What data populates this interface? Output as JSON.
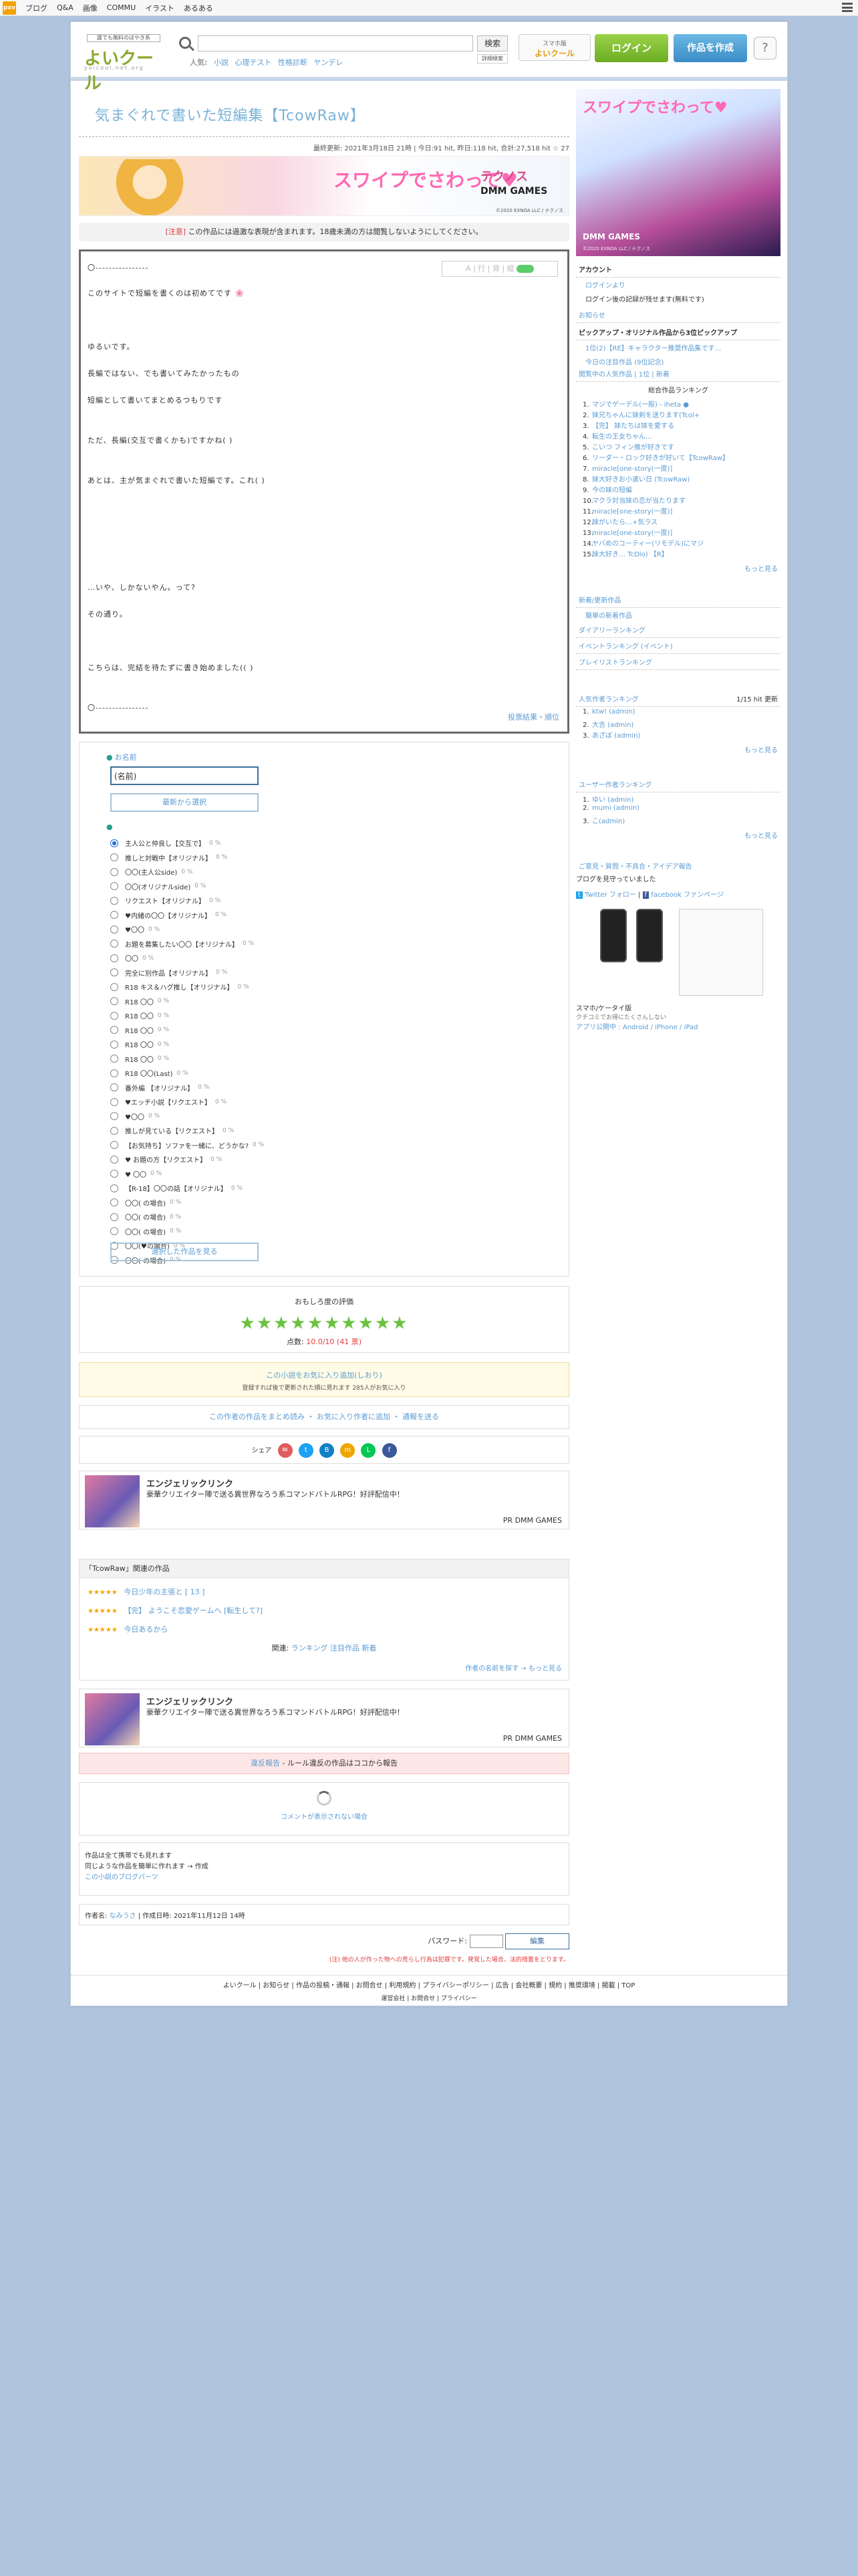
{
  "topnav": {
    "logo": "pxv",
    "items": [
      "ブログ",
      "Q&A",
      "画像",
      "COMMU",
      "イラスト",
      "あるある"
    ]
  },
  "header": {
    "tagline": "誰でも無料のぼやき系",
    "wordmark": "よいクール",
    "wordmark_sub": "yoicool.net.org",
    "search_placeholder": "",
    "search_button": "検索",
    "search_detail": "詳細検索",
    "hints_label": "人気:",
    "hints": [
      "小説",
      "心理テスト",
      "性格診断",
      "ヤンデレ"
    ],
    "mobile_badge_top": "スマホ版",
    "mobile_badge_name": "よいクール",
    "login": "ログイン",
    "post": "作品を作成",
    "help": "?"
  },
  "work": {
    "title": "気まぐれで書いた短編集【TcowRaw】",
    "meta": "最終更新: 2021年3月18日 21時 | 今日:91 hit, 昨日:118 hit, 合計:27,518 hit ☆ 27",
    "notice_tag": "[注意]",
    "notice": "この作品には過激な表現が含まれます。18歳未満の方は閲覧しないようにしてください。",
    "controls": "A | 行 | 背 | 縦",
    "lines": [
      "〇----------------",
      "このサイトで短編を書くのは初めてです 🌸",
      "ゆるいです。",
      "長編ではない、でも書いてみたかったもの",
      "短編として書いてまとめるつもりです",
      "ただ、長編(交互で書くかも)ですかね( )",
      "あとは、主が気まぐれで書いた短編です。これ( )",
      "…いや、しかないやん。って?",
      "その通り。",
      "こちらは、完結を待たずに書き始めました(( )",
      "〇----------------"
    ],
    "rank_link": "投票結果・順位"
  },
  "vote": {
    "name_label": "お名前",
    "name_value": "(名前)",
    "recent_button": "最新から選択",
    "list_label": "",
    "options": [
      {
        "text": "主人公と仲良し【交互で】",
        "count": "0 %"
      },
      {
        "text": "推しと対戦中【オリジナル】",
        "count": "0 %"
      },
      {
        "text": "〇〇(主人公side)",
        "count": "0 %"
      },
      {
        "text": "〇〇(オリジナルside)",
        "count": "0 %"
      },
      {
        "text": "リクエスト【オリジナル】",
        "count": "0 %"
      },
      {
        "text": "♥内緒の〇〇【オリジナル】",
        "count": "0 %"
      },
      {
        "text": "♥〇〇",
        "count": "0 %"
      },
      {
        "text": "お題を募集したい〇〇【オリジナル】",
        "count": "0 %"
      },
      {
        "text": "〇〇",
        "count": "0 %"
      },
      {
        "text": "完全に別作品【オリジナル】",
        "count": "0 %"
      },
      {
        "text": "R18 キス＆ハグ推し【オリジナル】",
        "count": "0 %"
      },
      {
        "text": "R18 〇〇",
        "count": "0 %"
      },
      {
        "text": "R18 〇〇",
        "count": "0 %"
      },
      {
        "text": "R18 〇〇",
        "count": "0 %"
      },
      {
        "text": "R18 〇〇",
        "count": "0 %"
      },
      {
        "text": "R18 〇〇",
        "count": "0 %"
      },
      {
        "text": "R18 〇〇(Last)",
        "count": "0 %"
      },
      {
        "text": "番外編 【オリジナル】",
        "count": "0 %"
      },
      {
        "text": "♥エッチ小説【リクエスト】",
        "count": "0 %"
      },
      {
        "text": "♥〇〇",
        "count": "0 %"
      },
      {
        "text": "推しが見ている【リクエスト】",
        "count": "0 %"
      },
      {
        "text": "【お気持ち】ソファを一緒に、どうかな?",
        "count": "0 %"
      },
      {
        "text": "♥ お題の方【リクエスト】",
        "count": "0 %"
      },
      {
        "text": "♥ 〇〇",
        "count": "0 %"
      },
      {
        "text": "【R-18】〇〇の話【オリジナル】",
        "count": "0 %"
      },
      {
        "text": "〇〇( の場合)",
        "count": "0 %"
      },
      {
        "text": "〇〇( の場合)",
        "count": "0 %"
      },
      {
        "text": "〇〇( の場合)",
        "count": "0 %"
      },
      {
        "text": "〇〇(♥の場合)",
        "count": "0 %"
      },
      {
        "text": "〇〇( の場合)",
        "count": "0 %"
      }
    ],
    "show_button": "選択した作品を見る"
  },
  "rating": {
    "heading": "おもしろ度の評価",
    "stars": "★★★★★★★★★★",
    "score_label": "点数:",
    "score": "10.0/10 (41 票)"
  },
  "fav": {
    "text": "この小説をお気に入り追加(しおり)",
    "sub": "登録すれば後で更新された順に見れます 285人がお気に入り"
  },
  "actions": {
    "a1": "この作者の作品をまとめ読み",
    "a2": "お気に入り作者に追加",
    "a3": "通報を送る"
  },
  "share": {
    "label": "シェア",
    "icons": [
      "✉",
      "t",
      "B",
      "m",
      "L",
      "f"
    ]
  },
  "ads": [
    {
      "title": "エンジェリックリンク",
      "desc": "豪華クリエイター陣で送る異世界なろう系コマンドバトルRPG！好評配信中！",
      "pr": "PR DMM GAMES"
    },
    {
      "title": "エンジェリックリンク",
      "desc": "豪華クリエイター陣で送る異世界なろう系コマンドバトルRPG！好評配信中！",
      "pr": "PR DMM GAMES"
    }
  ],
  "related": {
    "heading": "「TcowRaw」関連の作品",
    "items": [
      {
        "stars": "★★★★★",
        "text": "今日少年の主張と [ 13 ]"
      },
      {
        "stars": "★★★★★",
        "text": "【完】 ようこそ恋愛ゲームへ [転生して?]"
      },
      {
        "stars": "★★★★★",
        "text": "今日あるから"
      }
    ],
    "footer_label": "関連:",
    "footer": [
      "ランキング",
      "注目作品",
      "新着"
    ],
    "more": "作者の名前を探す → もっと見る"
  },
  "pink": {
    "link": "違反報告",
    "text": "- ルール違反の作品はココから報告"
  },
  "loading": {
    "text": "コメントが表示されない場合"
  },
  "mobile_read": {
    "l1": "作品は全て携帯でも見れます",
    "l2": "同じような作品を簡単に作れます → 作成",
    "l3": "この小説のブログパーツ"
  },
  "author": {
    "label": "作者名:",
    "name": "なみうさ",
    "created_label": "作成日時:",
    "created": "2021年11月12日 14時"
  },
  "pw": {
    "label": "パスワード:",
    "button": "編集"
  },
  "pw_note": "(注) 他の人が作った物への荒らし行為は犯罪です。発覚した場合、法的措置をとります。",
  "side": {
    "banner_title": "スワイプでさわって♥",
    "banner_brand": "DMM GAMES",
    "banner_copy": "©2020 EXNOA LLC / テクノス",
    "account_hd": "アカウント",
    "account_items": [
      "ログインより",
      "ログイン後の記録が残せます(無料です)"
    ],
    "news_hd": "お知らせ",
    "pickup_hd": "ピックアップ・オリジナル作品から3位ピックアップ",
    "pickup_items": [
      "1位(2)【RE】キャラクター推奨作品集です…",
      "今日の注目作品 (9位記念)"
    ],
    "rank_hd": "閲覧中の人気作品 | 1位 | 新着",
    "rank_sub": "総合作品ランキング",
    "rank_items": [
      "マジでゲーデル(一般) - iheta ●",
      "妹兄ちゃんに妹剣を送ります(Tcol+",
      "【完】 妹たちは妹を愛する",
      "転生の王女ちゃん...",
      "こいつ フィン推が好きです",
      "リーダー・ロック好きが好いて【TcowRaw】",
      "miracle[one-story(一度)]",
      "妹大好きお小遣い日 (TcowRaw)",
      "今の妹の短編",
      "マクラ対当妹の恋が当たります",
      "miracle[one-story(一度)]",
      "妹がいたら…+気ラス",
      "miracle[one-story(一度)]",
      "ヤバめのコーティー(リモデル)にマジ",
      "妹大好き… TcDlo) 【R】"
    ],
    "rank_more": "もっと見る",
    "tag_hd": "新着/更新作品",
    "tag_items": [
      "簡単の新着作品"
    ],
    "diary_hd": "ダイアリーランキング",
    "event_hd": "イベントランキング (イベント)",
    "playlist_hd": "プレイリストランキング",
    "author_hd": "人気作者ランキング",
    "author_sub": "1/15 hit 更新",
    "author_items": [
      "ktw! (admin)",
      "大吉 (admin)",
      "あざぼ (admin)"
    ],
    "author_more": "もっと見る",
    "user_hd": "ユーザー作者ランキング",
    "user_items": [
      "ゆい (admin)",
      "mumi (admin)",
      "こ(admin)"
    ],
    "user_more": "もっと見る",
    "contact": "ご意見・質問・不具合・アイデア報告",
    "contact_sub": "ブログを見守っていました",
    "twitter": "Twitter",
    "twitter_follow": "フォロー",
    "facebook": "facebook",
    "facebook_follow": "ファンページ",
    "smart_title": "スマホ/ケータイ版",
    "smart_sub": "クチコミでお得にたくさんしない",
    "app": "アプリ公開中 : Android / iPhone / iPad"
  },
  "footer": {
    "links": "よいクール | お知らせ | 作品の投稿・通報 | お問合せ | 利用規約 | プライバシーポリシー | 広告 | 会社概要 | 規約 | 推奨環境 | 掲載 | TOP",
    "line2": "運営会社 | お問合せ | プライバシー"
  }
}
